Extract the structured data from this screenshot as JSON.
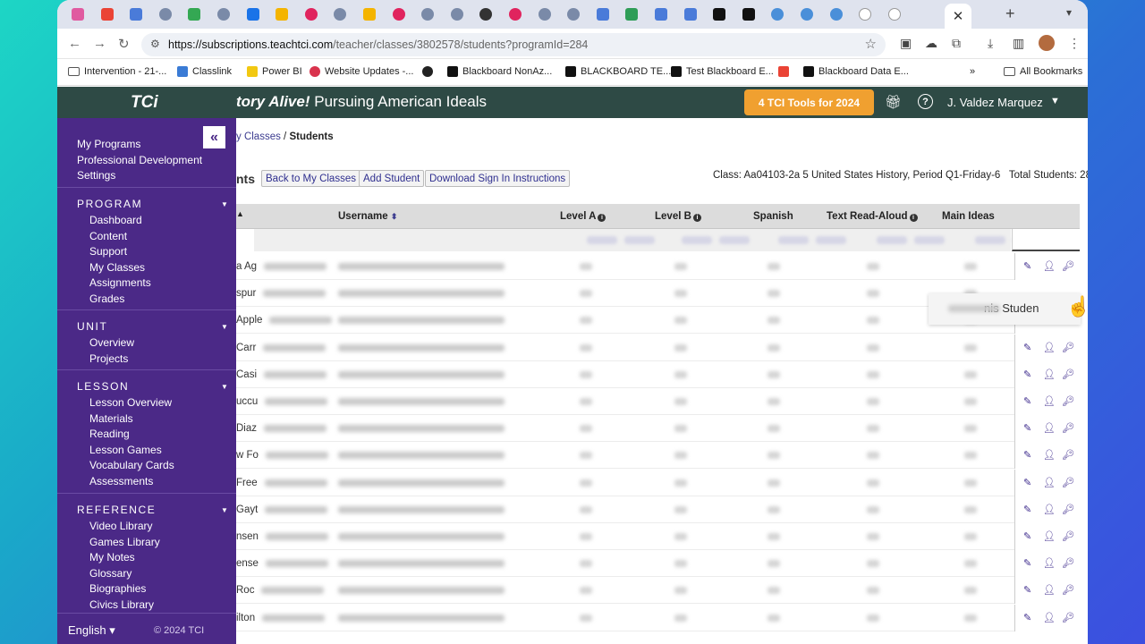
{
  "browser": {
    "tab_icons": [
      "pink-tile",
      "gmail",
      "docs",
      "circle-icon",
      "drive",
      "circle-icon",
      "calendar",
      "slides",
      "tci-red",
      "circle-icon",
      "slides",
      "tci-red",
      "circle-icon",
      "circle-icon",
      "dark-circle",
      "tci-red",
      "circle-icon",
      "circle-icon",
      "docs",
      "sheets-green",
      "docs",
      "docs",
      "a-black",
      "a-black",
      "cloud-icon",
      "cloud-icon",
      "cloud-icon",
      "tci-tab",
      "tci-tab"
    ],
    "active_tab_close": "✕",
    "new_tab": "+",
    "url_host": "https://subscriptions.teachtci.com",
    "url_path": "/teacher/classes/3802578/students?programId=284"
  },
  "bookmarks": [
    {
      "label": "Intervention - 21-...",
      "icon": "folder"
    },
    {
      "label": "Classlink",
      "icon": "cloud"
    },
    {
      "label": "Power BI",
      "icon": "powerbi"
    },
    {
      "label": "Website Updates -...",
      "icon": "red-dot"
    },
    {
      "label": "",
      "icon": "globe"
    },
    {
      "label": "Blackboard NonAz...",
      "icon": "bb"
    },
    {
      "label": "BLACKBOARD TE...",
      "icon": "bb"
    },
    {
      "label": "Test Blackboard E...",
      "icon": "bb"
    },
    {
      "label": "",
      "icon": "gmail"
    },
    {
      "label": "Blackboard Data E...",
      "icon": "bb"
    }
  ],
  "bookmarks_more": "»",
  "all_bookmarks": "All Bookmarks",
  "app": {
    "logo": "TCi",
    "program_title_italic": "tory Alive!",
    "program_title_rest": " Pursuing American Ideals",
    "tools_button": "4 TCI Tools for 2024",
    "user_name": "J. Valdez Marquez"
  },
  "sidebar": {
    "top_links": [
      "My Programs",
      "Professional Development",
      "Settings"
    ],
    "sections": [
      {
        "title": "PROGRAM",
        "items": [
          "Dashboard",
          "Content",
          "Support",
          "My Classes",
          "Assignments",
          "Grades"
        ]
      },
      {
        "title": "UNIT",
        "items": [
          "Overview",
          "Projects"
        ]
      },
      {
        "title": "LESSON",
        "items": [
          "Lesson Overview",
          "Materials",
          "Reading",
          "Lesson Games",
          "Vocabulary Cards",
          "Assessments"
        ]
      },
      {
        "title": "REFERENCE",
        "items": [
          "Video Library",
          "Games Library",
          "My Notes",
          "Glossary",
          "Biographies",
          "Civics Library"
        ]
      }
    ],
    "language": "English",
    "copyright": "© 2024 TCI"
  },
  "content": {
    "breadcrumb_link": "y Classes",
    "breadcrumb_sep": " / ",
    "breadcrumb_current": "Students",
    "heading_fragment": "nts",
    "buttons": [
      "Back to My Classes",
      "Add Student",
      "Download Sign In Instructions"
    ],
    "class_info": "Class: Aa04103-2a 5 United States History, Period Q1-Friday-6",
    "total_students": "Total Students: 28",
    "columns": [
      "Username",
      "Level A",
      "Level B",
      "Spanish",
      "Text Read-Aloud",
      "Main Ideas"
    ],
    "row_name_fragments": [
      "a Ag",
      "spur",
      "Apple",
      "Carr",
      "Casi",
      "uccu",
      "Diaz",
      "w Fo",
      "Free",
      "Gayt",
      "nsen",
      "ense",
      "Roc",
      "ilton"
    ],
    "tooltip_text": "nis Studen"
  }
}
